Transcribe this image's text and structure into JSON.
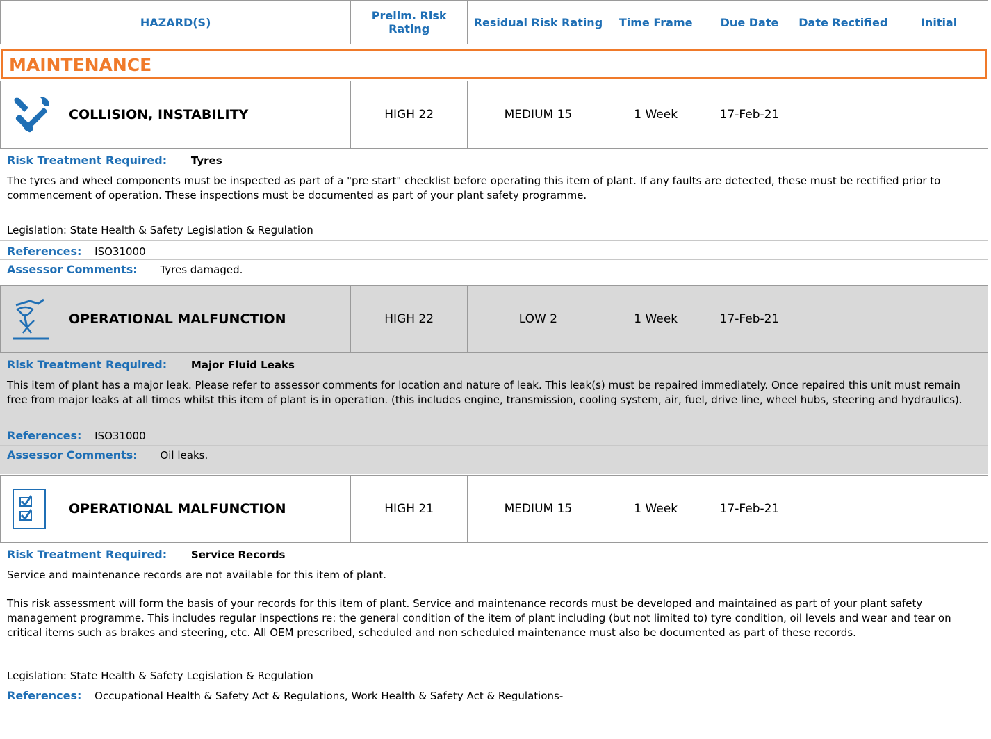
{
  "header": {
    "hazards": "HAZARD(S)",
    "prelim": "Prelim. Risk Rating",
    "residual": "Residual Risk Rating",
    "time_frame": "Time Frame",
    "due_date": "Due Date",
    "date_rectified": "Date Rectified",
    "initial": "Initial"
  },
  "section_title": "MAINTENANCE",
  "labels": {
    "risk_treatment": "Risk Treatment Required:",
    "references": "References:",
    "assessor_comments": "Assessor Comments:"
  },
  "hazards": [
    {
      "icon": "tools-icon",
      "name": "COLLISION, INSTABILITY",
      "prelim": "HIGH 22",
      "residual": "MEDIUM 15",
      "time_frame": "1 Week",
      "due_date": "17-Feb-21",
      "date_rectified": "",
      "initial": "",
      "treatment": "Tyres",
      "description": "The tyres and wheel components must be inspected as part of a \"pre start\" checklist before operating this item of plant. If any faults are detected, these must be rectified prior to commencement of operation. These inspections must be documented as part of your plant safety programme.",
      "legislation": "Legislation: State Health & Safety Legislation & Regulation",
      "references": "ISO31000",
      "comments": "Tyres damaged."
    },
    {
      "icon": "leak-icon",
      "name": "OPERATIONAL MALFUNCTION",
      "prelim": "HIGH 22",
      "residual": "LOW 2",
      "time_frame": "1 Week",
      "due_date": "17-Feb-21",
      "date_rectified": "",
      "initial": "",
      "treatment": "Major Fluid Leaks",
      "description": "This item of plant has a major leak. Please refer to assessor comments for location and nature of leak. This leak(s) must be repaired immediately. Once repaired this unit must remain free from major leaks at all times whilst this item of plant is in operation. (this includes engine, transmission, cooling system, air, fuel, drive line, wheel hubs, steering and hydraulics).",
      "references": "ISO31000",
      "comments": "Oil leaks."
    },
    {
      "icon": "checklist-icon",
      "name": "OPERATIONAL MALFUNCTION",
      "prelim": "HIGH 21",
      "residual": "MEDIUM 15",
      "time_frame": "1 Week",
      "due_date": "17-Feb-21",
      "date_rectified": "",
      "initial": "",
      "treatment": "Service Records",
      "description1": "Service and maintenance records are not available for this item of plant.",
      "description2": "This risk assessment will form the basis of your records for this item of plant. Service and maintenance records must be developed and maintained as part of your plant safety management programme. This includes regular inspections re: the general condition of the item of plant including (but not limited to) tyre condition, oil levels and wear and tear on critical items such as brakes and steering, etc. All OEM prescribed, scheduled and non scheduled maintenance must also be documented as part of these records.",
      "legislation": "Legislation: State Health & Safety Legislation & Regulation",
      "references": "Occupational Health & Safety Act & Regulations, Work Health & Safety Act & Regulations-"
    }
  ]
}
